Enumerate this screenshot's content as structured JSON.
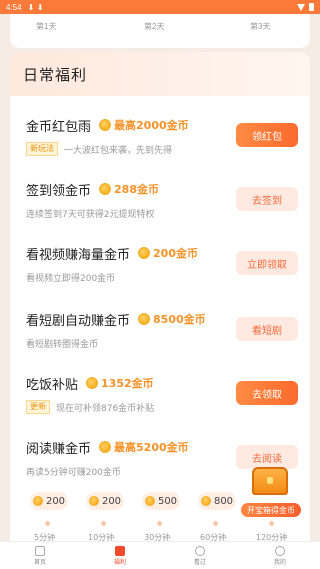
{
  "status_bar": {
    "time": "4:54",
    "download_glyph": "⬇ ⬇"
  },
  "day_strip": {
    "days": [
      "第1天",
      "第2天",
      "第3天"
    ]
  },
  "card": {
    "title": "日常福利"
  },
  "tasks": [
    {
      "title": "金币红包雨",
      "reward": "最高2000金币",
      "tag": "新玩法",
      "desc": "一大波红包来袭，先到先得",
      "button": "领红包",
      "button_style": "primary"
    },
    {
      "title": "签到领金币",
      "reward": "288金币",
      "tag": "",
      "desc": "连续签到7天可获得2元提现特权",
      "button": "去签到",
      "button_style": "light"
    },
    {
      "title": "看视频赚海量金币",
      "reward": "200金币",
      "tag": "",
      "desc": "看视频立即得200金币",
      "button": "立即领取",
      "button_style": "light"
    },
    {
      "title": "看短剧自动赚金币",
      "reward": "8500金币",
      "tag": "",
      "desc": "看短剧转圈得金币",
      "button": "看短剧",
      "button_style": "light"
    },
    {
      "title": "吃饭补贴",
      "reward": "1352金币",
      "tag": "更新",
      "desc": "现在可补领876金币补贴",
      "button": "去领取",
      "button_style": "primary"
    },
    {
      "title": "阅读赚金币",
      "reward": "最高5200金币",
      "tag": "",
      "desc": "再读5分钟可赚200金币",
      "button": "去阅读",
      "button_style": "light"
    }
  ],
  "reading_progress": {
    "rewards": [
      "200",
      "200",
      "500",
      "800"
    ],
    "minutes": [
      "5分钟",
      "10分钟",
      "30分钟",
      "60分钟",
      "120分钟"
    ]
  },
  "chest": {
    "label": "开宝箱得金币"
  },
  "bottom_nav": {
    "items": [
      {
        "label": "首页",
        "icon": "home-icon",
        "active": false
      },
      {
        "label": "福利",
        "icon": "gift-icon",
        "active": true
      },
      {
        "label": "看过",
        "icon": "star-icon",
        "active": false
      },
      {
        "label": "我的",
        "icon": "person-icon",
        "active": false
      }
    ]
  },
  "colors": {
    "accent": "#fb7a3a",
    "coin": "#f7932a",
    "active_nav": "#f04a2a"
  }
}
